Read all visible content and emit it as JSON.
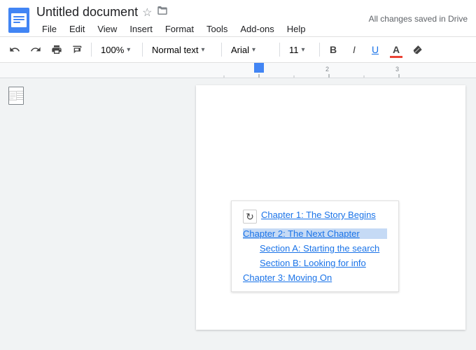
{
  "titleBar": {
    "docTitle": "Untitled document",
    "starLabel": "☆",
    "folderLabel": "⊡",
    "savedStatus": "All changes saved in Drive",
    "menu": [
      "File",
      "Edit",
      "View",
      "Insert",
      "Format",
      "Tools",
      "Add-ons",
      "Help"
    ]
  },
  "toolbar": {
    "undo": "↩",
    "redo": "↪",
    "print": "🖨",
    "paintFormat": "🖌",
    "zoom": "100%",
    "zoomChevron": "▾",
    "style": "Normal text",
    "styleChevron": "▾",
    "font": "Arial",
    "fontChevron": "▾",
    "size": "11",
    "sizeChevron": "▾",
    "bold": "B",
    "italic": "I",
    "underline": "U",
    "textColor": "A",
    "highlight": "✏"
  },
  "toc": {
    "refreshIcon": "↻",
    "entries": [
      {
        "label": "Chapter 1: The Story Begins",
        "level": "h1",
        "selected": false
      },
      {
        "label": "Chapter 2: The Next Chapter",
        "level": "h1",
        "selected": true
      },
      {
        "label": "Section A: Starting the search",
        "level": "h2",
        "selected": false
      },
      {
        "label": "Section B: Looking for info",
        "level": "h2",
        "selected": false
      },
      {
        "label": "Chapter 3: Moving On",
        "level": "h1",
        "selected": false
      }
    ]
  }
}
